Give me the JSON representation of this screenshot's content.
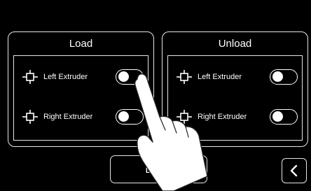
{
  "load_panel": {
    "title": "Load",
    "rows": [
      {
        "label": "Left Extruder",
        "icon": "extruder-icon",
        "toggle_on": false
      },
      {
        "label": "Right Extruder",
        "icon": "extruder-icon",
        "toggle_on": false
      }
    ]
  },
  "unload_panel": {
    "title": "Unload",
    "rows": [
      {
        "label": "Left Extruder",
        "icon": "extruder-icon",
        "toggle_on": false
      },
      {
        "label": "Right Extruder",
        "icon": "extruder-icon",
        "toggle_on": false
      }
    ]
  },
  "actions": {
    "begin_label": "Begin",
    "back_icon": "chevron-left-icon"
  },
  "colors": {
    "background": "#000000",
    "foreground": "#ffffff",
    "border": "#e6e6e6"
  }
}
